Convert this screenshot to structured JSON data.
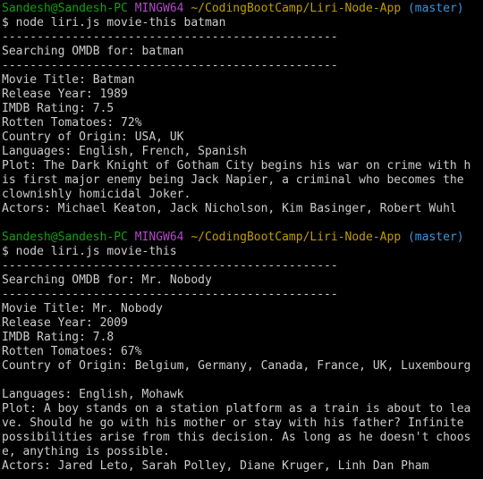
{
  "session1": {
    "prompt": {
      "user": "Sandesh@Sandesh-PC",
      "system": "MINGW64",
      "path": "~/CodingBootCamp/Liri-Node-App",
      "branch": "(master)"
    },
    "command": "$ node liri.js movie-this batman",
    "separator": "------------------------------------------------",
    "searching": "Searching OMDB for: batman",
    "fields": [
      "Movie Title: Batman",
      "Release Year: 1989",
      "IMDB Rating: 7.5",
      "Rotten Tomatoes: 72%",
      "Country of Origin: USA, UK",
      "Languages: English, French, Spanish",
      "Plot: The Dark Knight of Gotham City begins his war on crime with h",
      "is first major enemy being Jack Napier, a criminal who becomes the",
      "clownishly homicidal Joker.",
      "Actors: Michael Keaton, Jack Nicholson, Kim Basinger, Robert Wuhl"
    ]
  },
  "session2": {
    "prompt": {
      "user": "Sandesh@Sandesh-PC",
      "system": "MINGW64",
      "path": "~/CodingBootCamp/Liri-Node-App",
      "branch": "(master)"
    },
    "command": "$ node liri.js movie-this",
    "separator": "------------------------------------------------",
    "searching": "Searching OMDB for: Mr. Nobody",
    "fields": [
      "Movie Title: Mr. Nobody",
      "Release Year: 2009",
      "IMDB Rating: 7.8",
      "Rotten Tomatoes: 67%",
      "Country of Origin: Belgium, Germany, Canada, France, UK, Luxembourg",
      "",
      "Languages: English, Mohawk",
      "Plot: A boy stands on a station platform as a train is about to lea",
      "ve. Should he go with his mother or stay with his father? Infinite",
      "possibilities arise from this decision. As long as he doesn't choos",
      "e, anything is possible.",
      "Actors: Jared Leto, Sarah Polley, Diane Kruger, Linh Dan Pham"
    ]
  },
  "colors": {
    "background": "#000000",
    "text": "#cccccc",
    "user": "#13a10e",
    "system": "#b148c6",
    "path": "#c19c00",
    "branch": "#3a96dd"
  }
}
